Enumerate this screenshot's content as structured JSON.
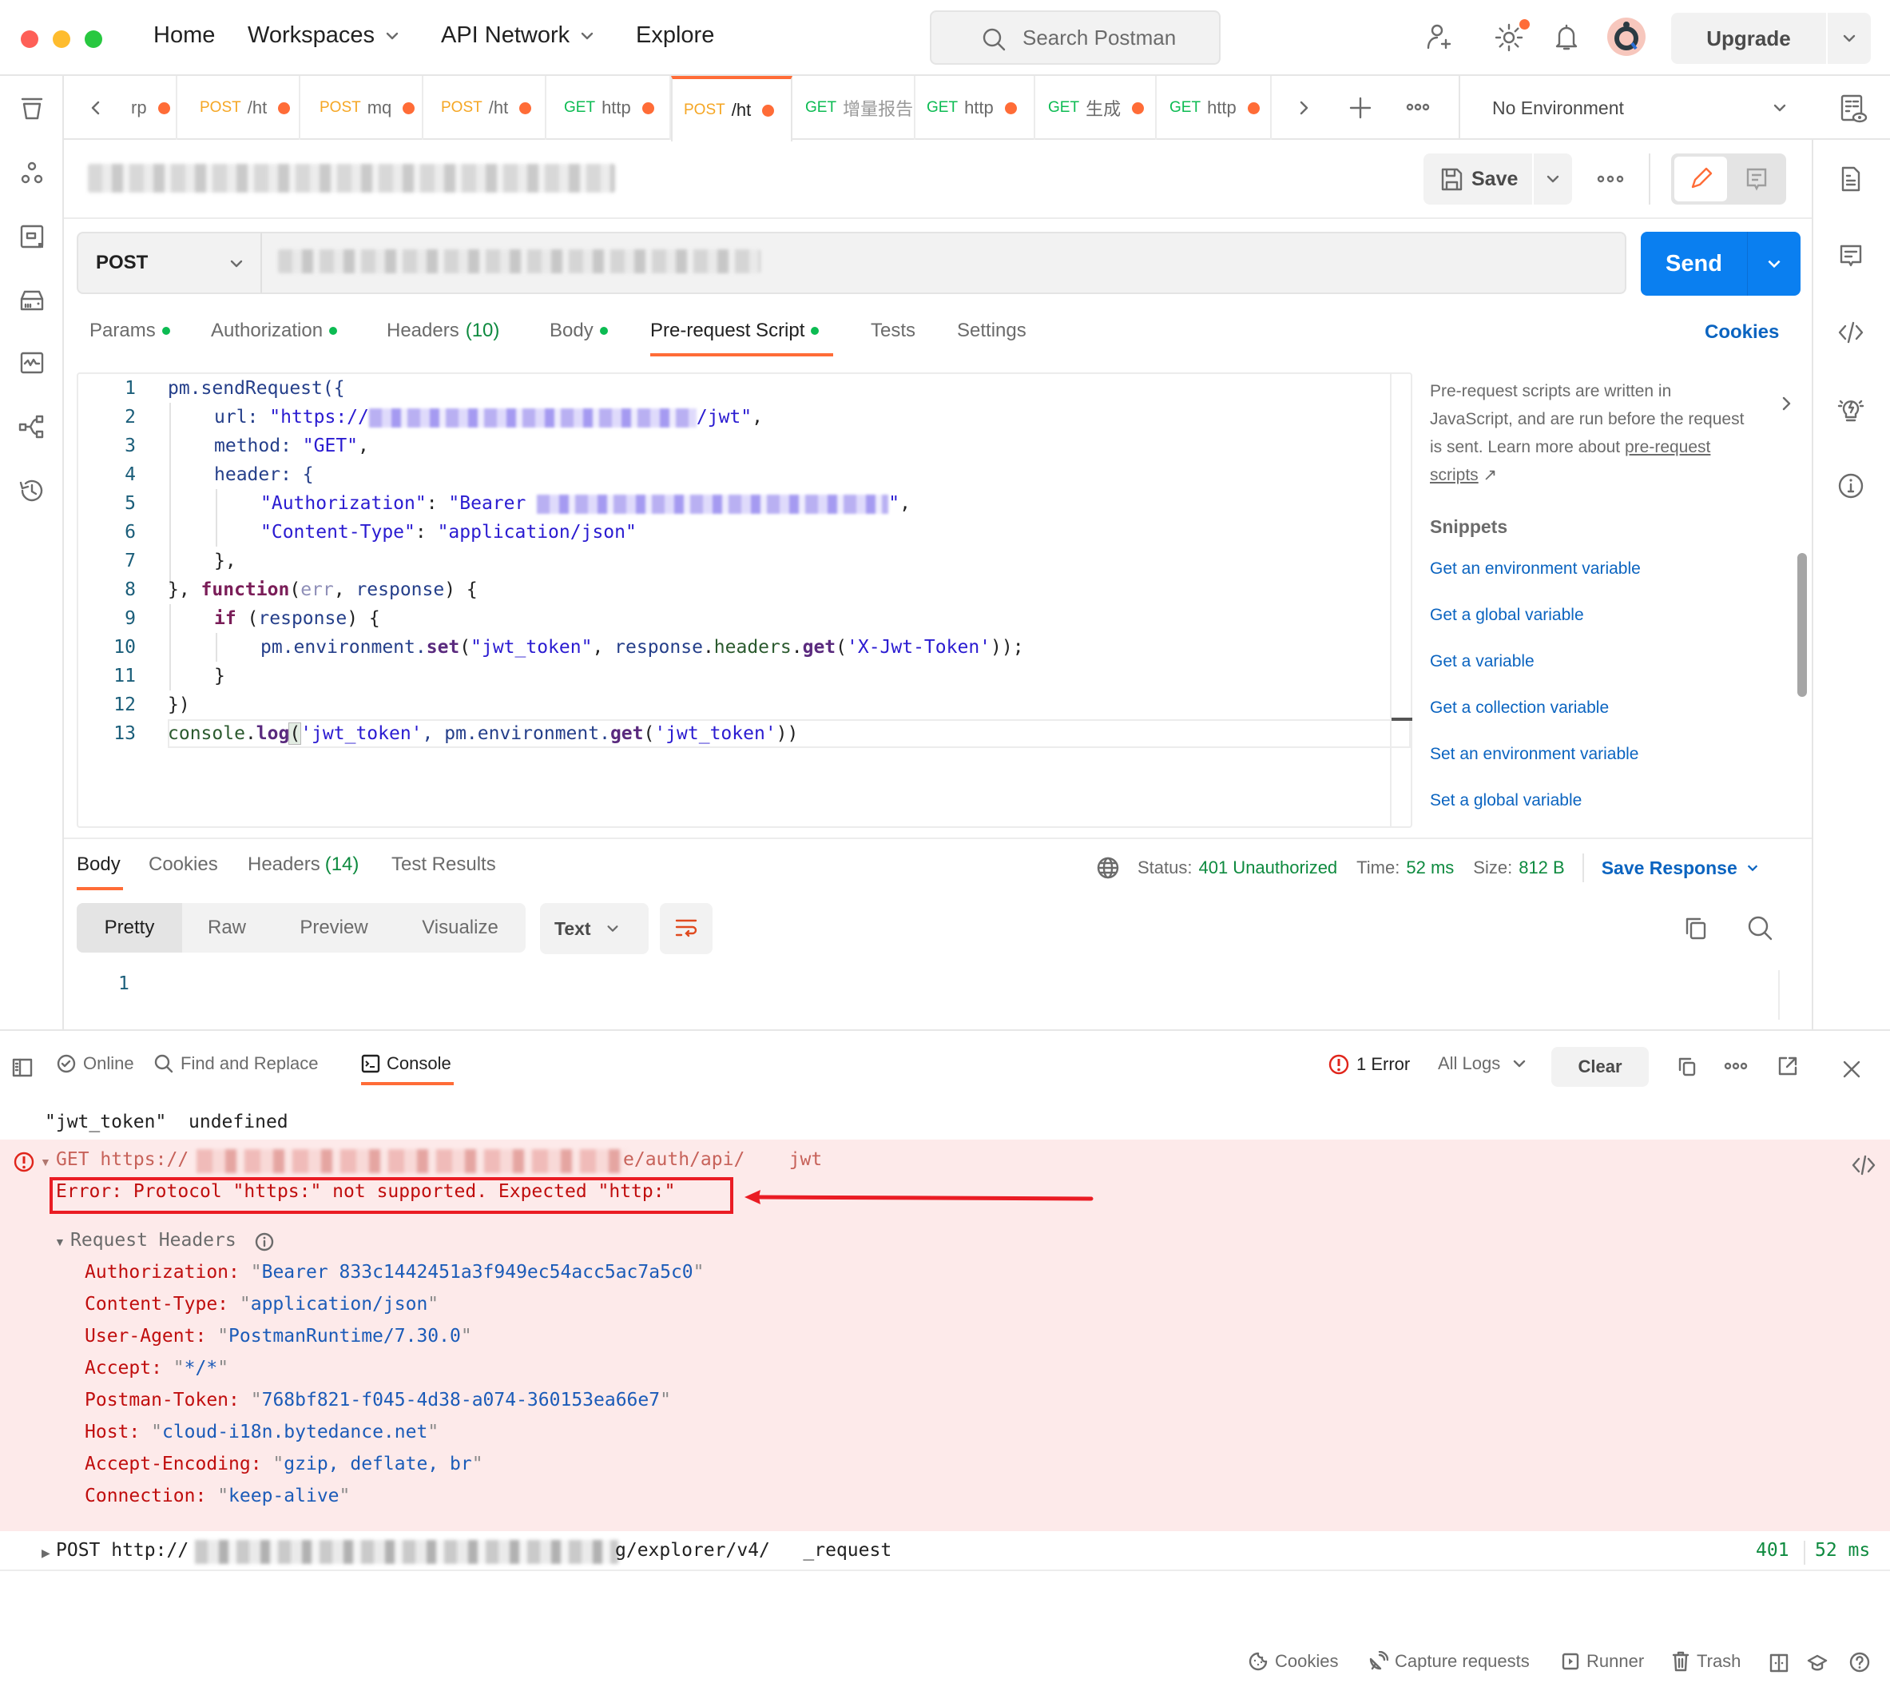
{
  "topbar": {
    "nav": [
      {
        "label": "Home",
        "has_dropdown": false
      },
      {
        "label": "Workspaces",
        "has_dropdown": true
      },
      {
        "label": "API Network",
        "has_dropdown": true
      },
      {
        "label": "Explore",
        "has_dropdown": false
      }
    ],
    "search_placeholder": "Search Postman",
    "upgrade_label": "Upgrade",
    "icons": [
      "invite-user-icon",
      "settings-icon",
      "notifications-icon",
      "avatar"
    ]
  },
  "tabs": [
    {
      "method": "",
      "label": "rp",
      "unsaved": true,
      "active": false
    },
    {
      "method": "POST",
      "label": "/ht",
      "unsaved": true,
      "active": false
    },
    {
      "method": "POST",
      "label": "mq",
      "unsaved": true,
      "active": false
    },
    {
      "method": "POST",
      "label": "/ht",
      "unsaved": true,
      "active": false
    },
    {
      "method": "GET",
      "label": "http",
      "unsaved": true,
      "active": false
    },
    {
      "method": "POST",
      "label": "/ht",
      "unsaved": true,
      "active": true
    },
    {
      "method": "GET",
      "label": "增量报告",
      "unsaved": false,
      "active": false
    },
    {
      "method": "GET",
      "label": "http",
      "unsaved": true,
      "active": false
    },
    {
      "method": "GET",
      "label": "生成",
      "unsaved": true,
      "active": false
    },
    {
      "method": "GET",
      "label": "http",
      "unsaved": true,
      "active": false
    }
  ],
  "environment": {
    "selected": "No Environment"
  },
  "request": {
    "save_label": "Save",
    "method": "POST",
    "send_label": "Send",
    "section_tabs": [
      {
        "label": "Params",
        "count": "",
        "dot": true,
        "active": false
      },
      {
        "label": "Authorization",
        "count": "",
        "dot": true,
        "active": false
      },
      {
        "label": "Headers",
        "count": "(10)",
        "dot": false,
        "active": false
      },
      {
        "label": "Body",
        "count": "",
        "dot": true,
        "active": false
      },
      {
        "label": "Pre-request Script",
        "count": "",
        "dot": true,
        "active": true
      },
      {
        "label": "Tests",
        "count": "",
        "dot": false,
        "active": false
      },
      {
        "label": "Settings",
        "count": "",
        "dot": false,
        "active": false
      }
    ],
    "cookies_label": "Cookies"
  },
  "editor": {
    "line_numbers": [
      "1",
      "2",
      "3",
      "4",
      "5",
      "6",
      "7",
      "8",
      "9",
      "10",
      "11",
      "12",
      "13"
    ],
    "lines": {
      "l1": "pm.sendRequest({",
      "l2_a": "url: ",
      "l2_b": "\"https://",
      "l2_c": "/jwt\"",
      "l2_d": ",",
      "l3_a": "method: ",
      "l3_b": "\"GET\"",
      "l3_c": ",",
      "l4": "header: {",
      "l5_a": "\"Authorization\"",
      "l5_b": ": ",
      "l5_c": "\"Bearer ",
      "l5_d": "\"",
      "l5_e": ",",
      "l6_a": "\"Content-Type\"",
      "l6_b": ": ",
      "l6_c": "\"application/json\"",
      "l7": "},",
      "l8_a": "}, ",
      "l8_b": "function",
      "l8_c": "(",
      "l8_d": "err",
      "l8_e": ", ",
      "l8_f": "response",
      "l8_g": ") {",
      "l9_a": "if",
      "l9_b": " (",
      "l9_c": "response",
      "l9_d": ") {",
      "l10_a": "pm.environment.",
      "l10_b": "set",
      "l10_c": "(",
      "l10_d": "\"jwt_token\"",
      "l10_e": ", ",
      "l10_f": "response",
      "l10_g": ".",
      "l10_h": "headers",
      "l10_i": ".",
      "l10_j": "get",
      "l10_k": "(",
      "l10_l": "'X-Jwt-Token'",
      "l10_m": "));",
      "l11": "}",
      "l12": "})",
      "l13_a": "console",
      "l13_b": ".",
      "l13_c": "log",
      "l13_d": "(",
      "l13_e": "'jwt_token'",
      "l13_f": ", pm.environment.",
      "l13_g": "get",
      "l13_h": "(",
      "l13_i": "'jwt_token'",
      "l13_j": "))"
    }
  },
  "snippets": {
    "description": "Pre-request scripts are written in JavaScript, and are run before the request is sent. Learn more about",
    "learn_link": "pre-request scripts",
    "heading": "Snippets",
    "items": [
      "Get an environment variable",
      "Get a global variable",
      "Get a variable",
      "Get a collection variable",
      "Set an environment variable",
      "Set a global variable"
    ]
  },
  "response": {
    "tabs": [
      {
        "label": "Body",
        "count": "",
        "active": true
      },
      {
        "label": "Cookies",
        "count": "",
        "active": false
      },
      {
        "label": "Headers",
        "count": "(14)",
        "active": false
      },
      {
        "label": "Test Results",
        "count": "",
        "active": false
      }
    ],
    "status_label": "Status:",
    "status_value": "401 Unauthorized",
    "time_label": "Time:",
    "time_value": "52 ms",
    "size_label": "Size:",
    "size_value": "812 B",
    "save_response_label": "Save Response",
    "view_modes": [
      "Pretty",
      "Raw",
      "Preview",
      "Visualize"
    ],
    "active_view": "Pretty",
    "format": "Text",
    "body_line_number": "1"
  },
  "console": {
    "bar": {
      "online_label": "Online",
      "find_replace_label": "Find and Replace",
      "console_label": "Console",
      "error_count_label": "1 Error",
      "log_filter": "All Logs",
      "clear_label": "Clear"
    },
    "log_line": "\"jwt_token\"  undefined",
    "error_entry": {
      "request": "GET https://",
      "url_tail": "e/auth/api/    jwt",
      "message": "Error: Protocol \"https:\" not supported. Expected \"http:\"",
      "request_headers_label": "Request Headers",
      "headers": [
        {
          "key": "Authorization:",
          "value": "Bearer 833c1442451a3f949ec54acc5ac7a5c0"
        },
        {
          "key": "Content-Type:",
          "value": "application/json"
        },
        {
          "key": "User-Agent:",
          "value": "PostmanRuntime/7.30.0"
        },
        {
          "key": "Accept:",
          "value": "*/*"
        },
        {
          "key": "Postman-Token:",
          "value": "768bf821-f045-4d38-a074-360153ea66e7"
        },
        {
          "key": "Host:",
          "value": "cloud-i18n.bytedance.net"
        },
        {
          "key": "Accept-Encoding:",
          "value": "gzip, deflate, br"
        },
        {
          "key": "Connection:",
          "value": "keep-alive"
        }
      ]
    },
    "post_entry": {
      "method_url": "POST http://",
      "url_tail": "g/explorer/v4/   _request",
      "status": "401",
      "time": "52 ms"
    }
  },
  "footer": {
    "items": [
      "Cookies",
      "Capture requests",
      "Runner",
      "Trash"
    ]
  },
  "colors": {
    "accent": "#ff6c37",
    "primary": "#0a7ff0",
    "link": "#0b64c0",
    "success": "#0e8a3f",
    "error": "#c00d0d",
    "error_bg": "#fdeaea",
    "annotation": "#ea1c24"
  }
}
